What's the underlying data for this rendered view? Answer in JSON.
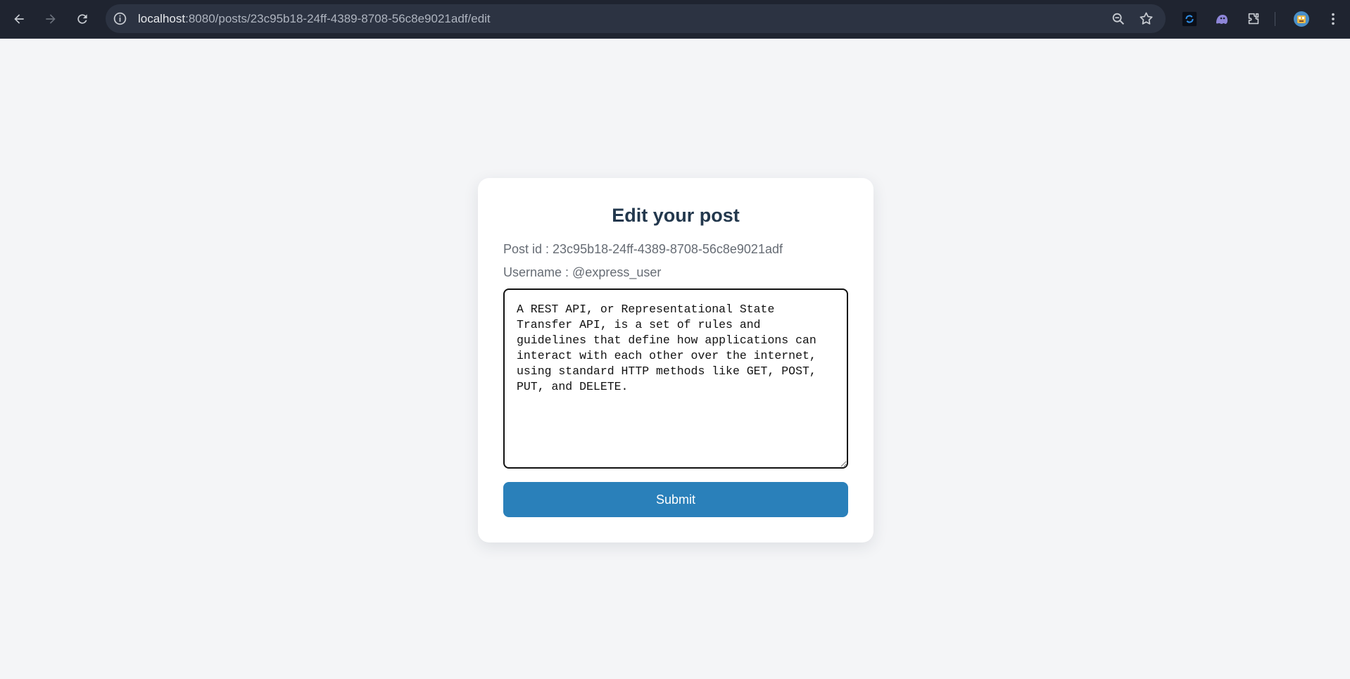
{
  "browser": {
    "url_host": "localhost",
    "url_rest": ":8080/posts/23c95b18-24ff-4389-8708-56c8e9021adf/edit",
    "icons": [
      "back-icon",
      "forward-icon",
      "reload-icon",
      "site-info-icon",
      "zoom-icon",
      "bookmark-star-icon",
      "extension-1-icon",
      "extension-ghost-icon",
      "extensions-puzzle-icon",
      "profile-avatar",
      "menu-dots-icon"
    ]
  },
  "page": {
    "title": "Edit your post",
    "post_id_line": "Post id : 23c95b18-24ff-4389-8708-56c8e9021adf",
    "username_line": "Username : @express_user",
    "content": "A REST API, or Representational State Transfer API, is a set of rules and guidelines that define how applications can interact with each other over the internet, using standard HTTP methods like GET, POST, PUT, and DELETE.",
    "submit_label": "Submit"
  },
  "colors": {
    "accent": "#2a80ba",
    "title": "#23384d",
    "background": "#f4f5f7",
    "chrome": "#1f2430"
  }
}
